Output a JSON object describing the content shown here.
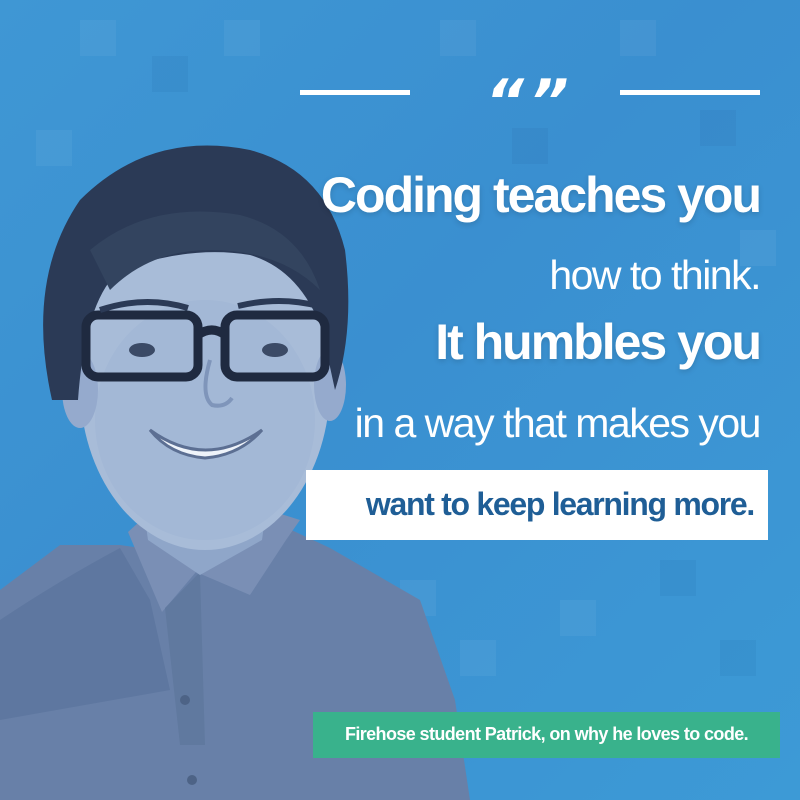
{
  "quote": {
    "line1": "Coding teaches you",
    "line2": "how to think.",
    "line3": "It humbles you",
    "line4": "in a way that makes you",
    "highlight": "want to keep learning more."
  },
  "caption": "Firehose student Patrick, on why he loves to code.",
  "colors": {
    "background": "#3d95d3",
    "highlight_text": "#1f5e96",
    "caption_background": "#39b28c",
    "text": "#ffffff"
  },
  "icons": {
    "quote": "quotation-marks-icon"
  }
}
